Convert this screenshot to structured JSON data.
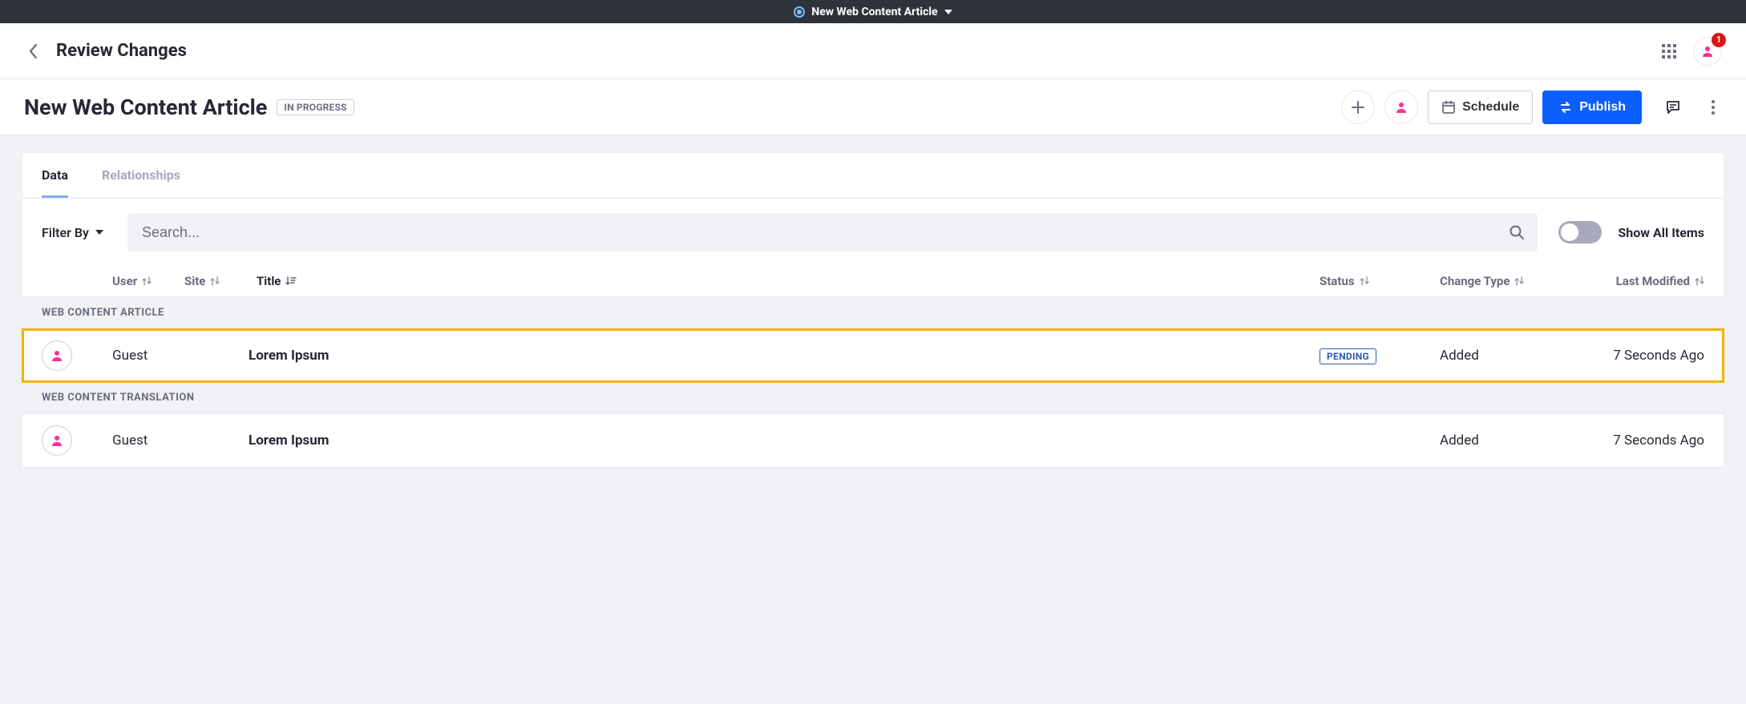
{
  "topbar": {
    "title": "New Web Content Article",
    "notification_count": "1"
  },
  "header": {
    "breadcrumb_title": "Review Changes",
    "page_title": "New Web Content Article",
    "status": "IN PROGRESS",
    "schedule_label": "Schedule",
    "publish_label": "Publish"
  },
  "tabs": {
    "data": "Data",
    "relationships": "Relationships"
  },
  "filters": {
    "filter_by_label": "Filter By",
    "search_placeholder": "Search...",
    "show_all_label": "Show All Items"
  },
  "columns": {
    "user": "User",
    "site": "Site",
    "title": "Title",
    "status": "Status",
    "change_type": "Change Type",
    "last_modified": "Last Modified"
  },
  "sections": [
    {
      "label": "WEB CONTENT ARTICLE",
      "highlighted": true,
      "rows": [
        {
          "site": "Guest",
          "title": "Lorem Ipsum",
          "status": "PENDING",
          "change_type": "Added",
          "last_modified": "7 Seconds Ago"
        }
      ]
    },
    {
      "label": "WEB CONTENT TRANSLATION",
      "highlighted": false,
      "rows": [
        {
          "site": "Guest",
          "title": "Lorem Ipsum",
          "status": "",
          "change_type": "Added",
          "last_modified": "7 Seconds Ago"
        }
      ]
    }
  ]
}
